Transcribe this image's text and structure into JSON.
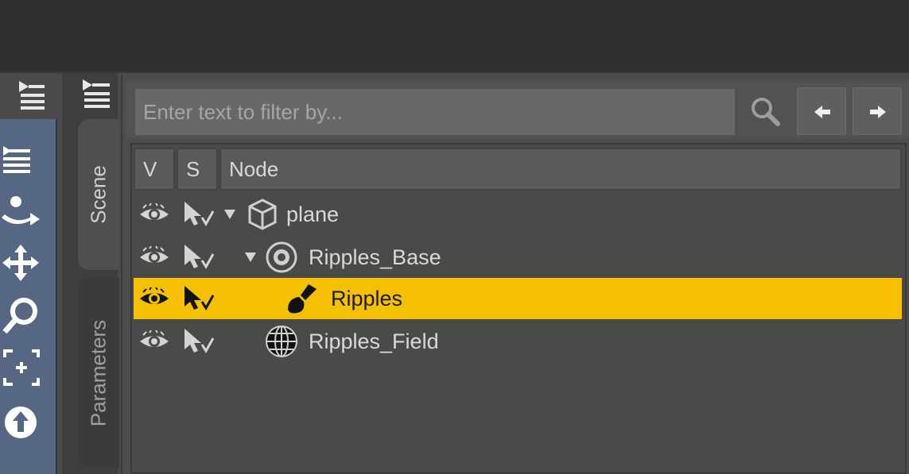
{
  "filter": {
    "placeholder": "Enter text to filter by..."
  },
  "tabs": {
    "scene": "Scene",
    "parameters": "Parameters"
  },
  "columns": {
    "visible": "V",
    "selectable": "S",
    "node": "Node"
  },
  "nodes": [
    {
      "name": "plane",
      "icon": "cube-icon",
      "expanded": true,
      "selected": false
    },
    {
      "name": "Ripples_Base",
      "icon": "circle-node-icon",
      "expanded": true,
      "selected": false
    },
    {
      "name": "Ripples",
      "icon": "brush-icon",
      "expanded": false,
      "selected": true
    },
    {
      "name": "Ripples_Field",
      "icon": "grid-sphere-icon",
      "expanded": false,
      "selected": false
    }
  ],
  "colors": {
    "selection": "#f5c000",
    "tool_strip": "#566783"
  }
}
